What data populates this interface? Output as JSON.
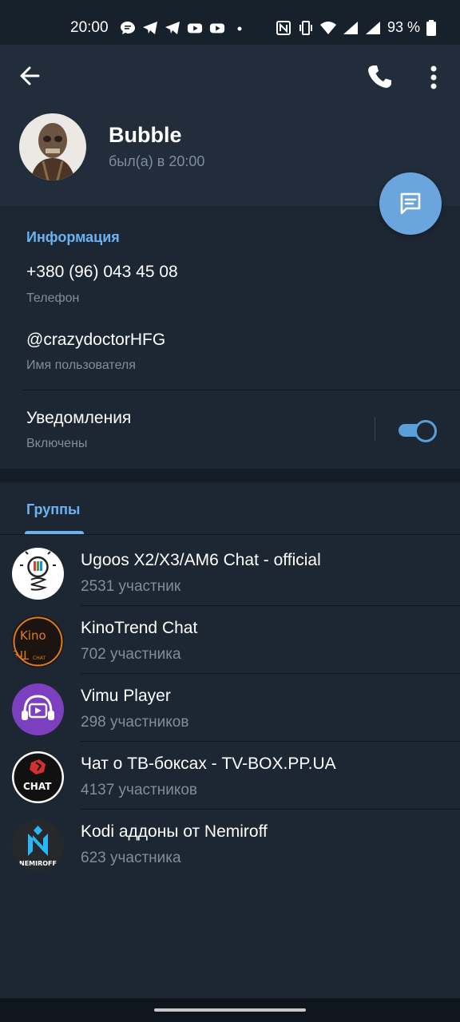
{
  "status_bar": {
    "time": "20:00",
    "battery": "93 %",
    "icons": [
      "chat-bubble-icon",
      "telegram-icon",
      "telegram-icon",
      "youtube-icon",
      "youtube-icon",
      "dot-icon",
      "nfc-icon",
      "vibrate-icon",
      "wifi-icon",
      "signal-icon",
      "signal-icon",
      "battery-icon"
    ]
  },
  "header": {
    "name": "Bubble",
    "last_seen": "был(а) в 20:00"
  },
  "info": {
    "title": "Информация",
    "phone": "+380 (96) 043 45 08",
    "phone_label": "Телефон",
    "username": "@crazydoctorHFG",
    "username_label": "Имя пользователя",
    "notifications_title": "Уведомления",
    "notifications_status": "Включены",
    "notifications_on": true
  },
  "groups": {
    "tab": "Группы",
    "items": [
      {
        "name": "Ugoos X2/X3/AM6 Chat - official",
        "count": "2531 участник"
      },
      {
        "name": "KinoTrend Chat",
        "count": "702 участника"
      },
      {
        "name": "Vimu Player",
        "count": "298 участников"
      },
      {
        "name": "Чат о ТВ-боксах - TV-BOX.PP.UA",
        "count": "4137 участников"
      },
      {
        "name": "Kodi аддоны от Nemiroff",
        "count": "623 участника"
      }
    ]
  },
  "colors": {
    "accent": "#6ab2f2",
    "background": "#1d2733",
    "header": "#212d3b",
    "fab": "#6ba5dd",
    "secondary_text": "#7f8d9c"
  }
}
